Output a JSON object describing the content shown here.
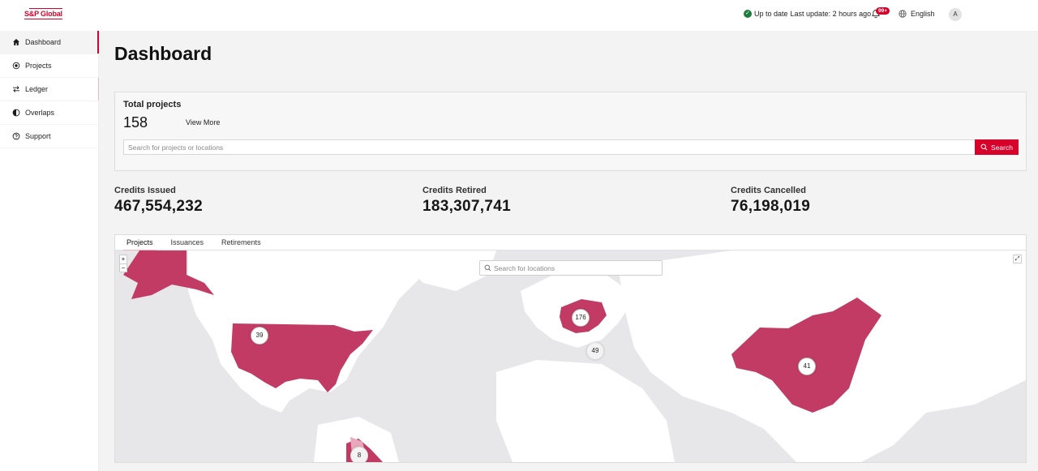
{
  "brand": {
    "logo_text": "S&P Global"
  },
  "header": {
    "status_text": "Up to date",
    "last_update": "Last update: 2 hours ago",
    "notification_badge": "99+",
    "language": "English",
    "avatar_initial": "A"
  },
  "sidebar": {
    "items": [
      {
        "label": "Dashboard",
        "icon": "home-icon"
      },
      {
        "label": "Projects",
        "icon": "target-icon"
      },
      {
        "label": "Ledger",
        "icon": "swap-icon"
      },
      {
        "label": "Overlaps",
        "icon": "contrast-icon"
      },
      {
        "label": "Support",
        "icon": "help-icon"
      }
    ]
  },
  "page": {
    "title": "Dashboard"
  },
  "projects_card": {
    "label": "Total projects",
    "count": "158",
    "view_more": "View More",
    "search_placeholder": "Search for projects or locations",
    "search_button": "Search"
  },
  "metrics": [
    {
      "label": "Credits Issued",
      "value": "467,554,232"
    },
    {
      "label": "Credits Retired",
      "value": "183,307,741"
    },
    {
      "label": "Credits Cancelled",
      "value": "76,198,019"
    }
  ],
  "map_panel": {
    "tabs": [
      "Projects",
      "Issuances",
      "Retirements"
    ],
    "active_tab": "Projects",
    "search_placeholder": "Search for locations",
    "zoom_in": "+",
    "zoom_out": "−",
    "clusters": [
      {
        "label": "39",
        "location": "United States"
      },
      {
        "label": "176",
        "location": "Central Europe"
      },
      {
        "label": "49",
        "location": "Mediterranean"
      },
      {
        "label": "41",
        "location": "China"
      },
      {
        "label": "8",
        "location": "Central America"
      }
    ],
    "colors": {
      "highlight": "#c23b64",
      "land": "#ffffff",
      "water": "#e7e7e9"
    }
  }
}
